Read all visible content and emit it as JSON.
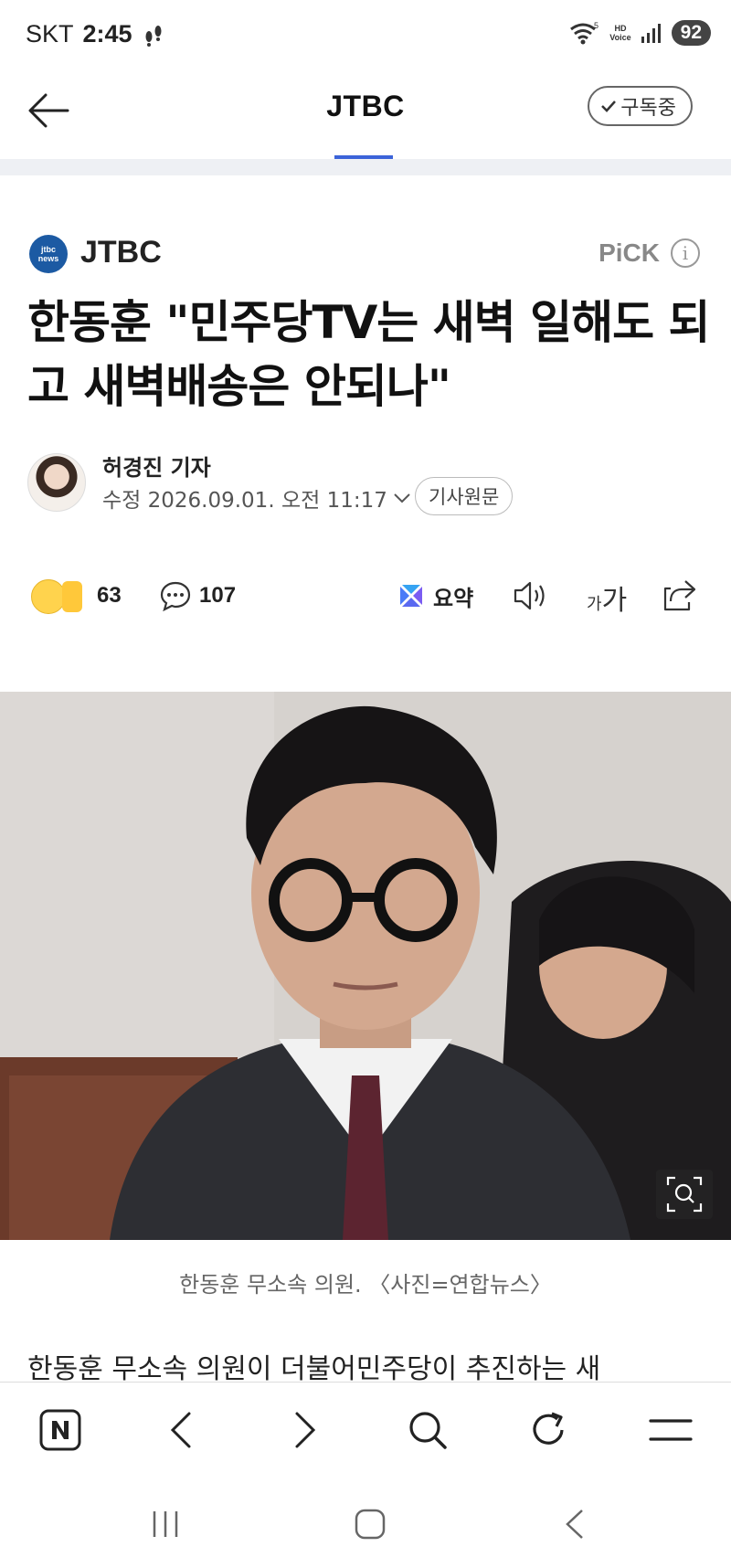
{
  "status_bar": {
    "carrier": "SKT",
    "time": "2:45",
    "network": "5",
    "hd_voice": [
      "HD",
      "Voice"
    ],
    "battery": "92"
  },
  "header": {
    "title": "JTBC",
    "subscribe_label": "구독중"
  },
  "article": {
    "press_logo": [
      "jtbc",
      "news"
    ],
    "press_name": "JTBC",
    "pick_label": "PiCK",
    "info_glyph": "i",
    "headline": "한동훈 \"민주당TV는 새벽 일해도 되고 새벽배송은 안되나\"",
    "author": "허경진 기자",
    "edited": "수정 2026.09.01. 오전 11:17",
    "original_label": "기사원문"
  },
  "actions": {
    "reactions_count": "63",
    "comments_count": "107",
    "summary_label": "요약",
    "font_small": "가",
    "font_large": "가"
  },
  "photo": {
    "caption": "한동훈 무소속 의원. 〈사진=연합뉴스〉"
  },
  "body": {
    "first_line": "한동훈 무소속 의원이 더불어민주당이 추진하는 새"
  },
  "icons": {
    "back": "arrow-left-icon",
    "check": "check-icon",
    "info": "info-icon",
    "reaction": "emoji-reaction-icon",
    "comment": "comment-icon",
    "summary": "ai-summary-icon",
    "speaker": "speaker-icon",
    "share": "share-icon",
    "zoom": "image-zoom-icon"
  },
  "colors": {
    "accent": "#3b63d9",
    "press_blue": "#1c5aa3"
  }
}
